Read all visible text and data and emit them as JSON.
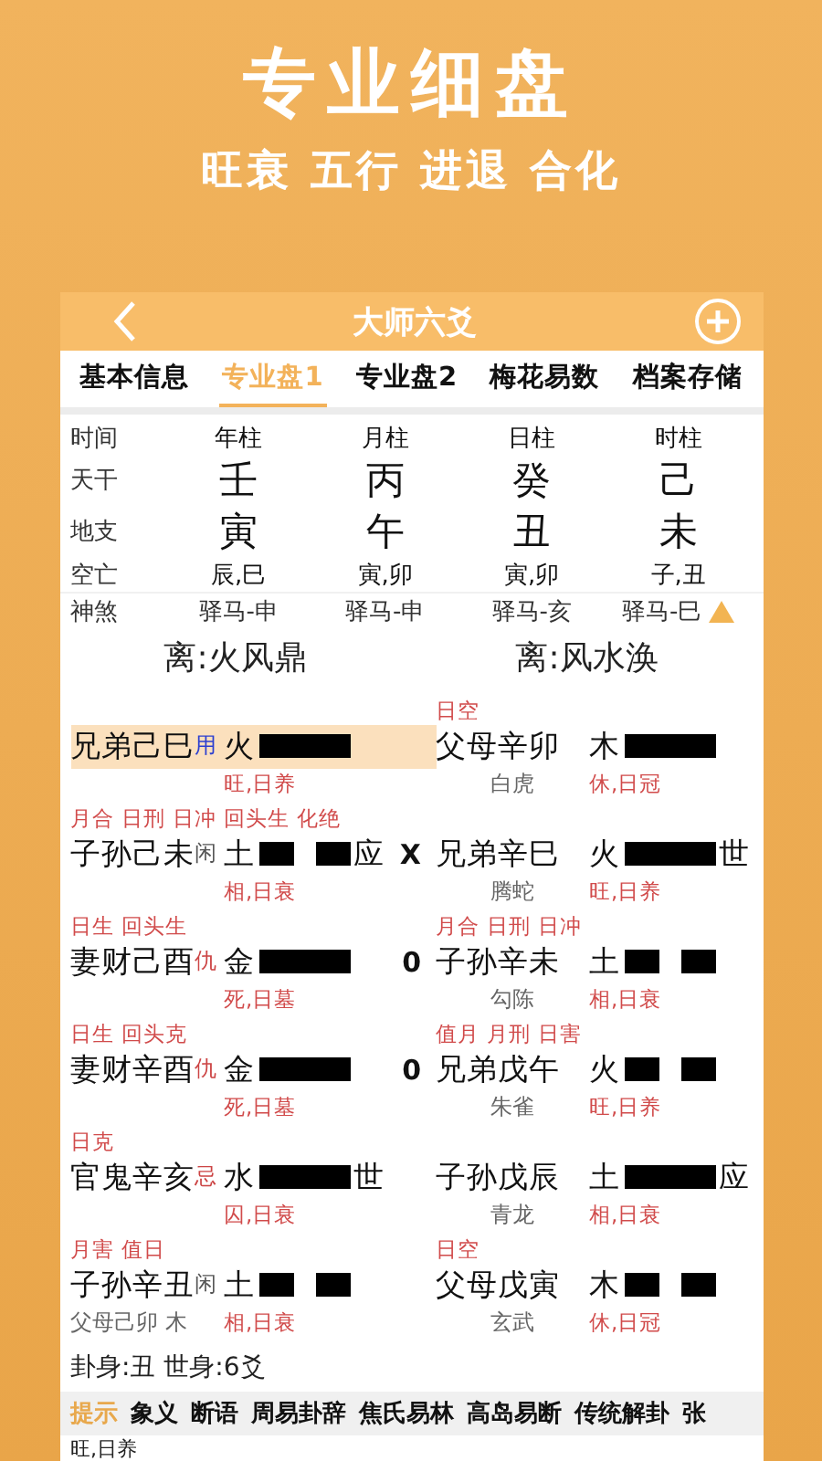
{
  "banner": {
    "title": "专业细盘",
    "subtitle": "旺衰 五行 进退 合化"
  },
  "header": {
    "title": "大师六爻"
  },
  "tabs": [
    {
      "label": "基本信息",
      "selected": false
    },
    {
      "label": "专业盘1",
      "selected": true
    },
    {
      "label": "专业盘2",
      "selected": false
    },
    {
      "label": "梅花易数",
      "selected": false
    },
    {
      "label": "档案存储",
      "selected": false
    }
  ],
  "pillar_table": [
    {
      "label": "时间",
      "kind": "head",
      "cells": [
        "年柱",
        "月柱",
        "日柱",
        "时柱"
      ]
    },
    {
      "label": "天干",
      "kind": "big",
      "cells": [
        "壬",
        "丙",
        "癸",
        "己"
      ]
    },
    {
      "label": "地支",
      "kind": "big",
      "cells": [
        "寅",
        "午",
        "丑",
        "未"
      ]
    },
    {
      "label": "空亡",
      "kind": "small",
      "cells": [
        "辰,巳",
        "寅,卯",
        "寅,卯",
        "子,丑"
      ]
    },
    {
      "label": "神煞",
      "kind": "shensha",
      "cells": [
        "驿马-申",
        "驿马-申",
        "驿马-亥",
        "驿马-巳"
      ]
    }
  ],
  "gua": [
    "离:火风鼎",
    "离:风水涣"
  ],
  "yao_rows": [
    {
      "left": {
        "name": "兄弟己巳",
        "marker": {
          "text": "用",
          "kind": "use"
        },
        "element": "火",
        "broken": false,
        "highlighted": true,
        "state": "旺,日养"
      },
      "right": {
        "tags": [
          "日空"
        ],
        "name": "父母辛卯",
        "element": "木",
        "broken": false,
        "beast": "白虎",
        "state": "休,日冠"
      }
    },
    {
      "left": {
        "tags": [
          "月合",
          "日刑",
          "日冲",
          "回头生",
          "化绝"
        ],
        "name": "子孙己未",
        "marker": {
          "text": "闲",
          "kind": "idle"
        },
        "element": "土",
        "broken": true,
        "suffix": "应",
        "highlighted": false,
        "move": "X",
        "state": "相,日衰"
      },
      "right": {
        "name": "兄弟辛巳",
        "element": "火",
        "broken": false,
        "suffix": "世",
        "beast": "腾蛇",
        "state": "旺,日养"
      }
    },
    {
      "left": {
        "tags": [
          "日生",
          "回头生"
        ],
        "name": "妻财己酉",
        "marker": {
          "text": "仇",
          "kind": "enemy"
        },
        "element": "金",
        "broken": false,
        "highlighted": false,
        "move": "0",
        "state": "死,日墓"
      },
      "right": {
        "tags": [
          "月合",
          "日刑",
          "日冲"
        ],
        "name": "子孙辛未",
        "element": "土",
        "broken": true,
        "beast": "勾陈",
        "state": "相,日衰"
      }
    },
    {
      "left": {
        "tags": [
          "日生",
          "回头克"
        ],
        "name": "妻财辛酉",
        "marker": {
          "text": "仇",
          "kind": "enemy"
        },
        "element": "金",
        "broken": false,
        "highlighted": false,
        "move": "0",
        "state": "死,日墓"
      },
      "right": {
        "tags": [
          "值月",
          "月刑",
          "日害"
        ],
        "name": "兄弟戊午",
        "element": "火",
        "broken": true,
        "beast": "朱雀",
        "state": "旺,日养"
      }
    },
    {
      "left": {
        "tags": [
          "日克"
        ],
        "name": "官鬼辛亥",
        "marker": {
          "text": "忌",
          "kind": "taboo"
        },
        "element": "水",
        "broken": false,
        "suffix": "世",
        "highlighted": false,
        "state": "囚,日衰"
      },
      "right": {
        "name": "子孙戊辰",
        "element": "土",
        "broken": false,
        "suffix": "应",
        "beast": "青龙",
        "state": "相,日衰"
      }
    },
    {
      "left": {
        "tags": [
          "月害",
          "值日"
        ],
        "name": "子孙辛丑",
        "marker": {
          "text": "闲",
          "kind": "idle"
        },
        "element": "土",
        "broken": true,
        "highlighted": false,
        "state": "相,日衰",
        "hidden": "父母己卯 木"
      },
      "right": {
        "tags": [
          "日空"
        ],
        "name": "父母戊寅",
        "element": "木",
        "broken": true,
        "beast": "玄武",
        "state": "休,日冠"
      }
    }
  ],
  "summary": "卦身:丑 世身:6爻",
  "bottom_tabs": [
    {
      "label": "提示",
      "selected": true
    },
    {
      "label": "象义",
      "selected": false
    },
    {
      "label": "断语",
      "selected": false
    },
    {
      "label": "周易卦辞",
      "selected": false
    },
    {
      "label": "焦氏易林",
      "selected": false
    },
    {
      "label": "高岛易断",
      "selected": false
    },
    {
      "label": "传统解卦",
      "selected": false
    },
    {
      "label": "张",
      "selected": false
    }
  ],
  "hint_text": "旺,日养"
}
